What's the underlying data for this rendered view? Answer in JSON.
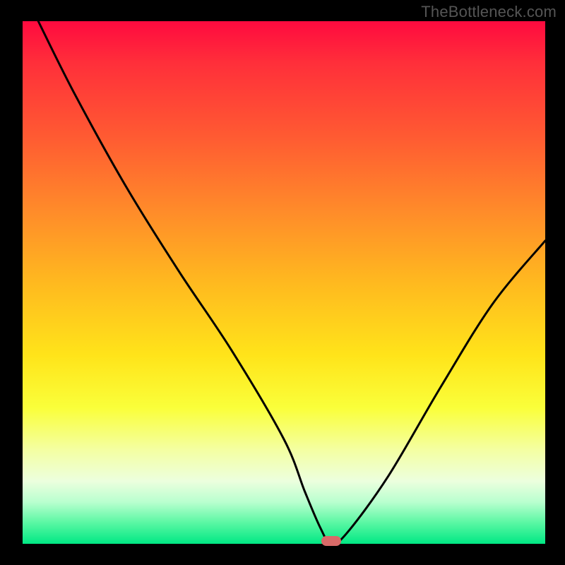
{
  "watermark": "TheBottleneck.com",
  "colors": {
    "page_bg": "#000000",
    "curve": "#000000",
    "marker": "#d86a68",
    "watermark_text": "#555555"
  },
  "chart_data": {
    "type": "line",
    "title": "",
    "xlabel": "",
    "ylabel": "",
    "xlim": [
      0,
      100
    ],
    "ylim": [
      0,
      100
    ],
    "grid": false,
    "legend": false,
    "series": [
      {
        "name": "bottleneck-curve",
        "x": [
          3,
          10,
          20,
          30,
          40,
          50,
          54,
          57,
          59,
          62,
          70,
          80,
          90,
          100
        ],
        "y": [
          100,
          86,
          68,
          52,
          37,
          20,
          10,
          3,
          0,
          2,
          13,
          30,
          46,
          58
        ]
      }
    ],
    "minimum_point": {
      "x": 59,
      "y": 0
    },
    "background_gradient": [
      {
        "pos": 0.0,
        "color": "#ff0a3f"
      },
      {
        "pos": 0.22,
        "color": "#ff5a32"
      },
      {
        "pos": 0.5,
        "color": "#ffb91f"
      },
      {
        "pos": 0.74,
        "color": "#faff3a"
      },
      {
        "pos": 0.88,
        "color": "#ecffde"
      },
      {
        "pos": 1.0,
        "color": "#00e884"
      }
    ]
  }
}
